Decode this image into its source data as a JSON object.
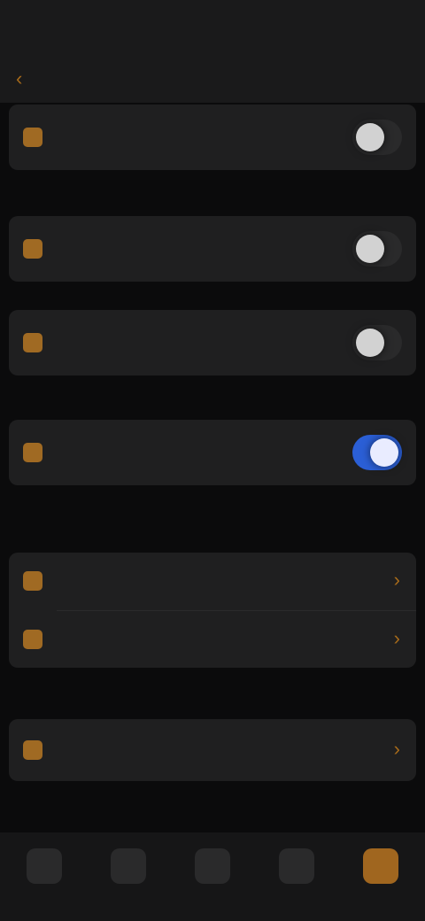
{
  "status": {
    "time": "",
    "right": ""
  },
  "header": {
    "back": "‹",
    "title": ""
  },
  "settings": [
    {
      "label": "",
      "desc": "",
      "enabled": false
    },
    {
      "label": "",
      "desc": "",
      "enabled": false
    },
    {
      "label": "",
      "desc": "",
      "enabled": false
    },
    {
      "label": "",
      "desc": "",
      "enabled": true
    }
  ],
  "links_group_1": [
    {
      "label": "",
      "chevron": "›"
    },
    {
      "label": "",
      "chevron": "›"
    }
  ],
  "links_group_2": [
    {
      "label": "",
      "chevron": "›"
    }
  ],
  "tabbar": {
    "active_index": 4,
    "tabs": [
      {
        "icon": "tab-icon-1"
      },
      {
        "icon": "tab-icon-2"
      },
      {
        "icon": "tab-icon-3"
      },
      {
        "icon": "tab-icon-4"
      },
      {
        "icon": "tab-icon-5"
      }
    ]
  },
  "colors": {
    "background": "#0b0b0c",
    "card": "#1f1f20",
    "accent": "#a06a23",
    "toggle_on": "#2b5fd6"
  }
}
